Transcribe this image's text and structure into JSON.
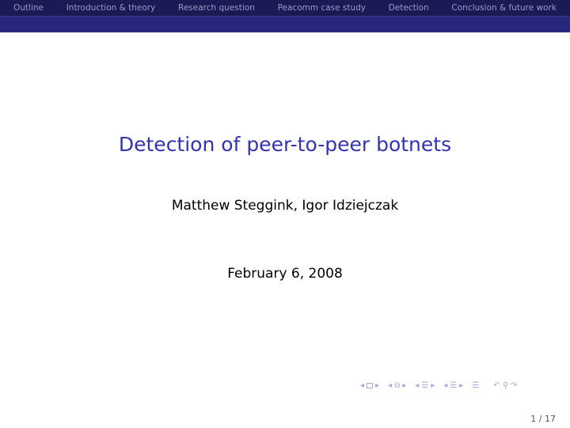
{
  "header": {
    "nav": [
      {
        "label": "Outline"
      },
      {
        "label": "Introduction & theory"
      },
      {
        "label": "Research question"
      },
      {
        "label": "Peacomm case study"
      },
      {
        "label": "Detection"
      },
      {
        "label": "Conclusion & future work"
      }
    ]
  },
  "slide": {
    "title": "Detection of peer-to-peer botnets",
    "authors": "Matthew Steggink, Igor Idziejczak",
    "date": "February 6, 2008"
  },
  "footer": {
    "page_number": "1 / 17",
    "nav_icons": [
      "frame-prev-icon",
      "frame-icon",
      "frame-next-icon",
      "subsection-prev-icon",
      "subsection-icon",
      "subsection-next-icon",
      "section-prev-icon",
      "section-icon",
      "section-next-icon",
      "slide-prev-icon",
      "slide-icon",
      "slide-next-icon",
      "toc-icon",
      "back-icon",
      "search-icon",
      "forward-icon"
    ]
  }
}
